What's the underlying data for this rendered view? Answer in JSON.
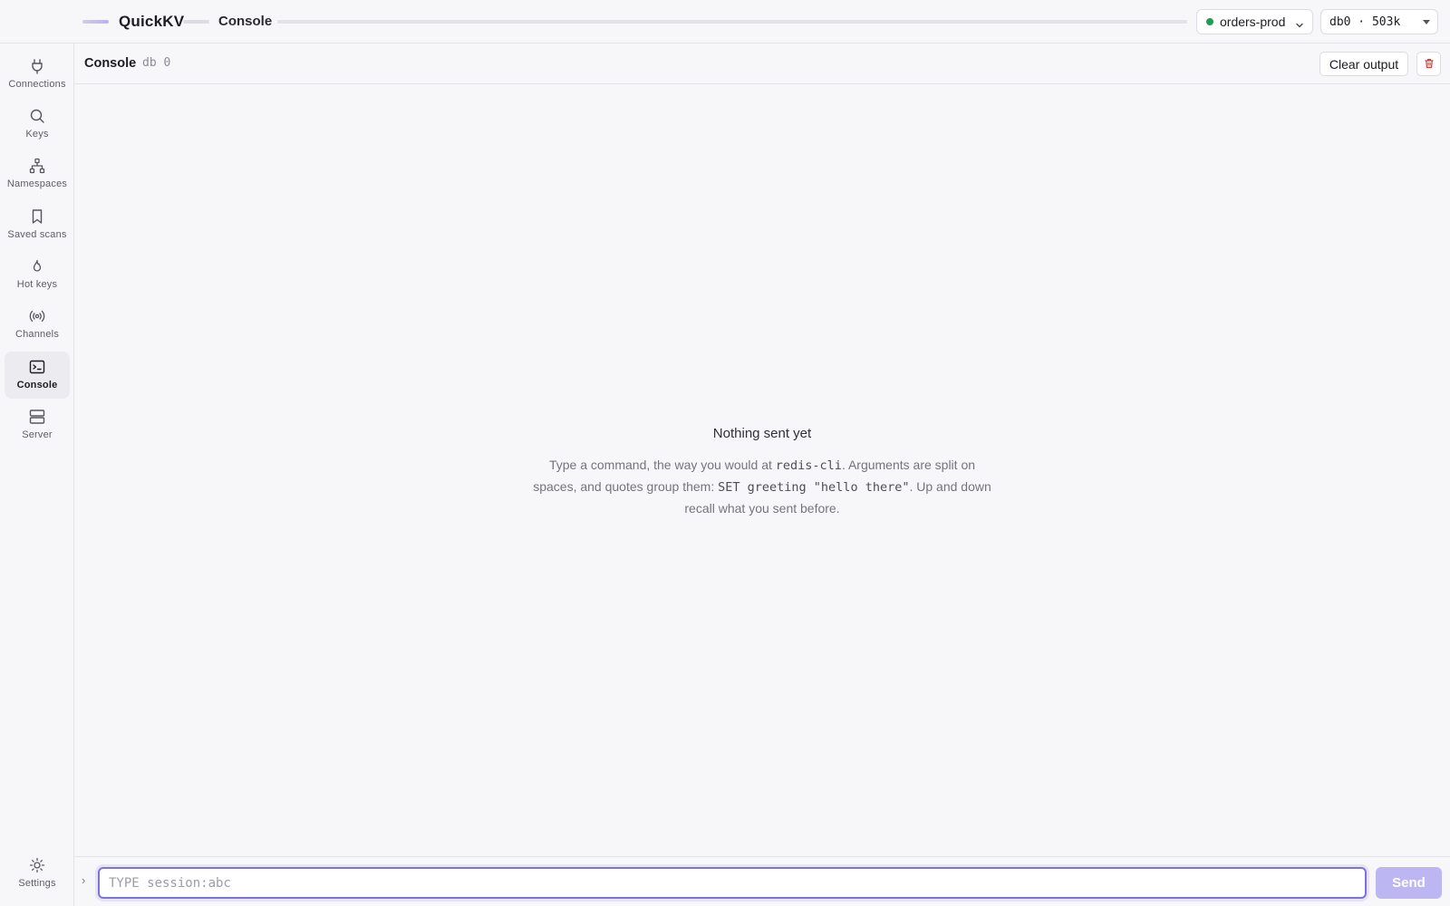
{
  "topbar": {
    "app_name": "QuickKV",
    "breadcrumb": "Console",
    "connection": {
      "name": "orders-prod",
      "status_color": "#1f9d57"
    },
    "db_select": {
      "value": "db0 · 503k"
    }
  },
  "sidebar": {
    "items": [
      {
        "label": "Connections",
        "icon": "plug-icon"
      },
      {
        "label": "Keys",
        "icon": "search-icon"
      },
      {
        "label": "Namespaces",
        "icon": "hierarchy-icon"
      },
      {
        "label": "Saved scans",
        "icon": "bookmark-icon"
      },
      {
        "label": "Hot keys",
        "icon": "flame-icon"
      },
      {
        "label": "Channels",
        "icon": "broadcast-icon"
      },
      {
        "label": "Console",
        "icon": "terminal-icon",
        "active": true
      },
      {
        "label": "Server",
        "icon": "server-icon"
      }
    ],
    "settings_label": "Settings"
  },
  "console": {
    "title": "Console",
    "db": "db 0",
    "clear_label": "Clear output"
  },
  "empty_state": {
    "title": "Nothing sent yet",
    "line1_a": "Type a command, the way you would at ",
    "line1_code": "redis-cli",
    "line1_b": ". Arguments are split on spaces, and quotes group them: ",
    "line2_code": "SET greeting \"hello there\"",
    "line2_b": ". Up and down recall what you sent before."
  },
  "input": {
    "prompt": "›",
    "placeholder": "TYPE session:abc",
    "value": "",
    "send_label": "Send"
  },
  "colors": {
    "accent": "#7d72dc",
    "send_disabled": "#bcb6f3",
    "danger": "#d63b3b"
  }
}
